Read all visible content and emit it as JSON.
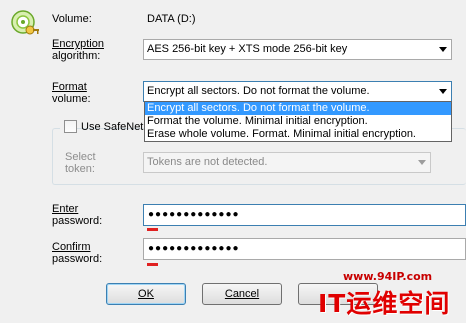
{
  "volume": {
    "label": "Volume:",
    "value": "DATA (D:)"
  },
  "encryption": {
    "label_line1": "Encryption",
    "label_line2": "algorithm:",
    "selected": "AES 256-bit key + XTS mode 256-bit key"
  },
  "format": {
    "label_line1": "Format",
    "label_line2": "volume:",
    "selected": "Encrypt all sectors. Do not format the volume.",
    "options": [
      "Encrypt all sectors. Do not format the volume.",
      "Format the volume. Minimal initial encryption.",
      "Erase whole volume. Format. Minimal initial encryption."
    ]
  },
  "safenet": {
    "checkbox_label": "Use SafeNet",
    "select_token_line1": "Select",
    "select_token_line2": "token:",
    "token_value": "Tokens are not detected."
  },
  "password": {
    "enter_line1": "Enter",
    "enter_line2": "password:",
    "enter_value": "●●●●●●●●●●●●●",
    "confirm_line1": "Confirm",
    "confirm_line2": "password:",
    "confirm_value": "●●●●●●●●●●●●●"
  },
  "buttons": {
    "ok": "OK",
    "cancel": "Cancel"
  },
  "watermark": {
    "url": "www.94IP.com",
    "brand": "IT运维空间"
  }
}
